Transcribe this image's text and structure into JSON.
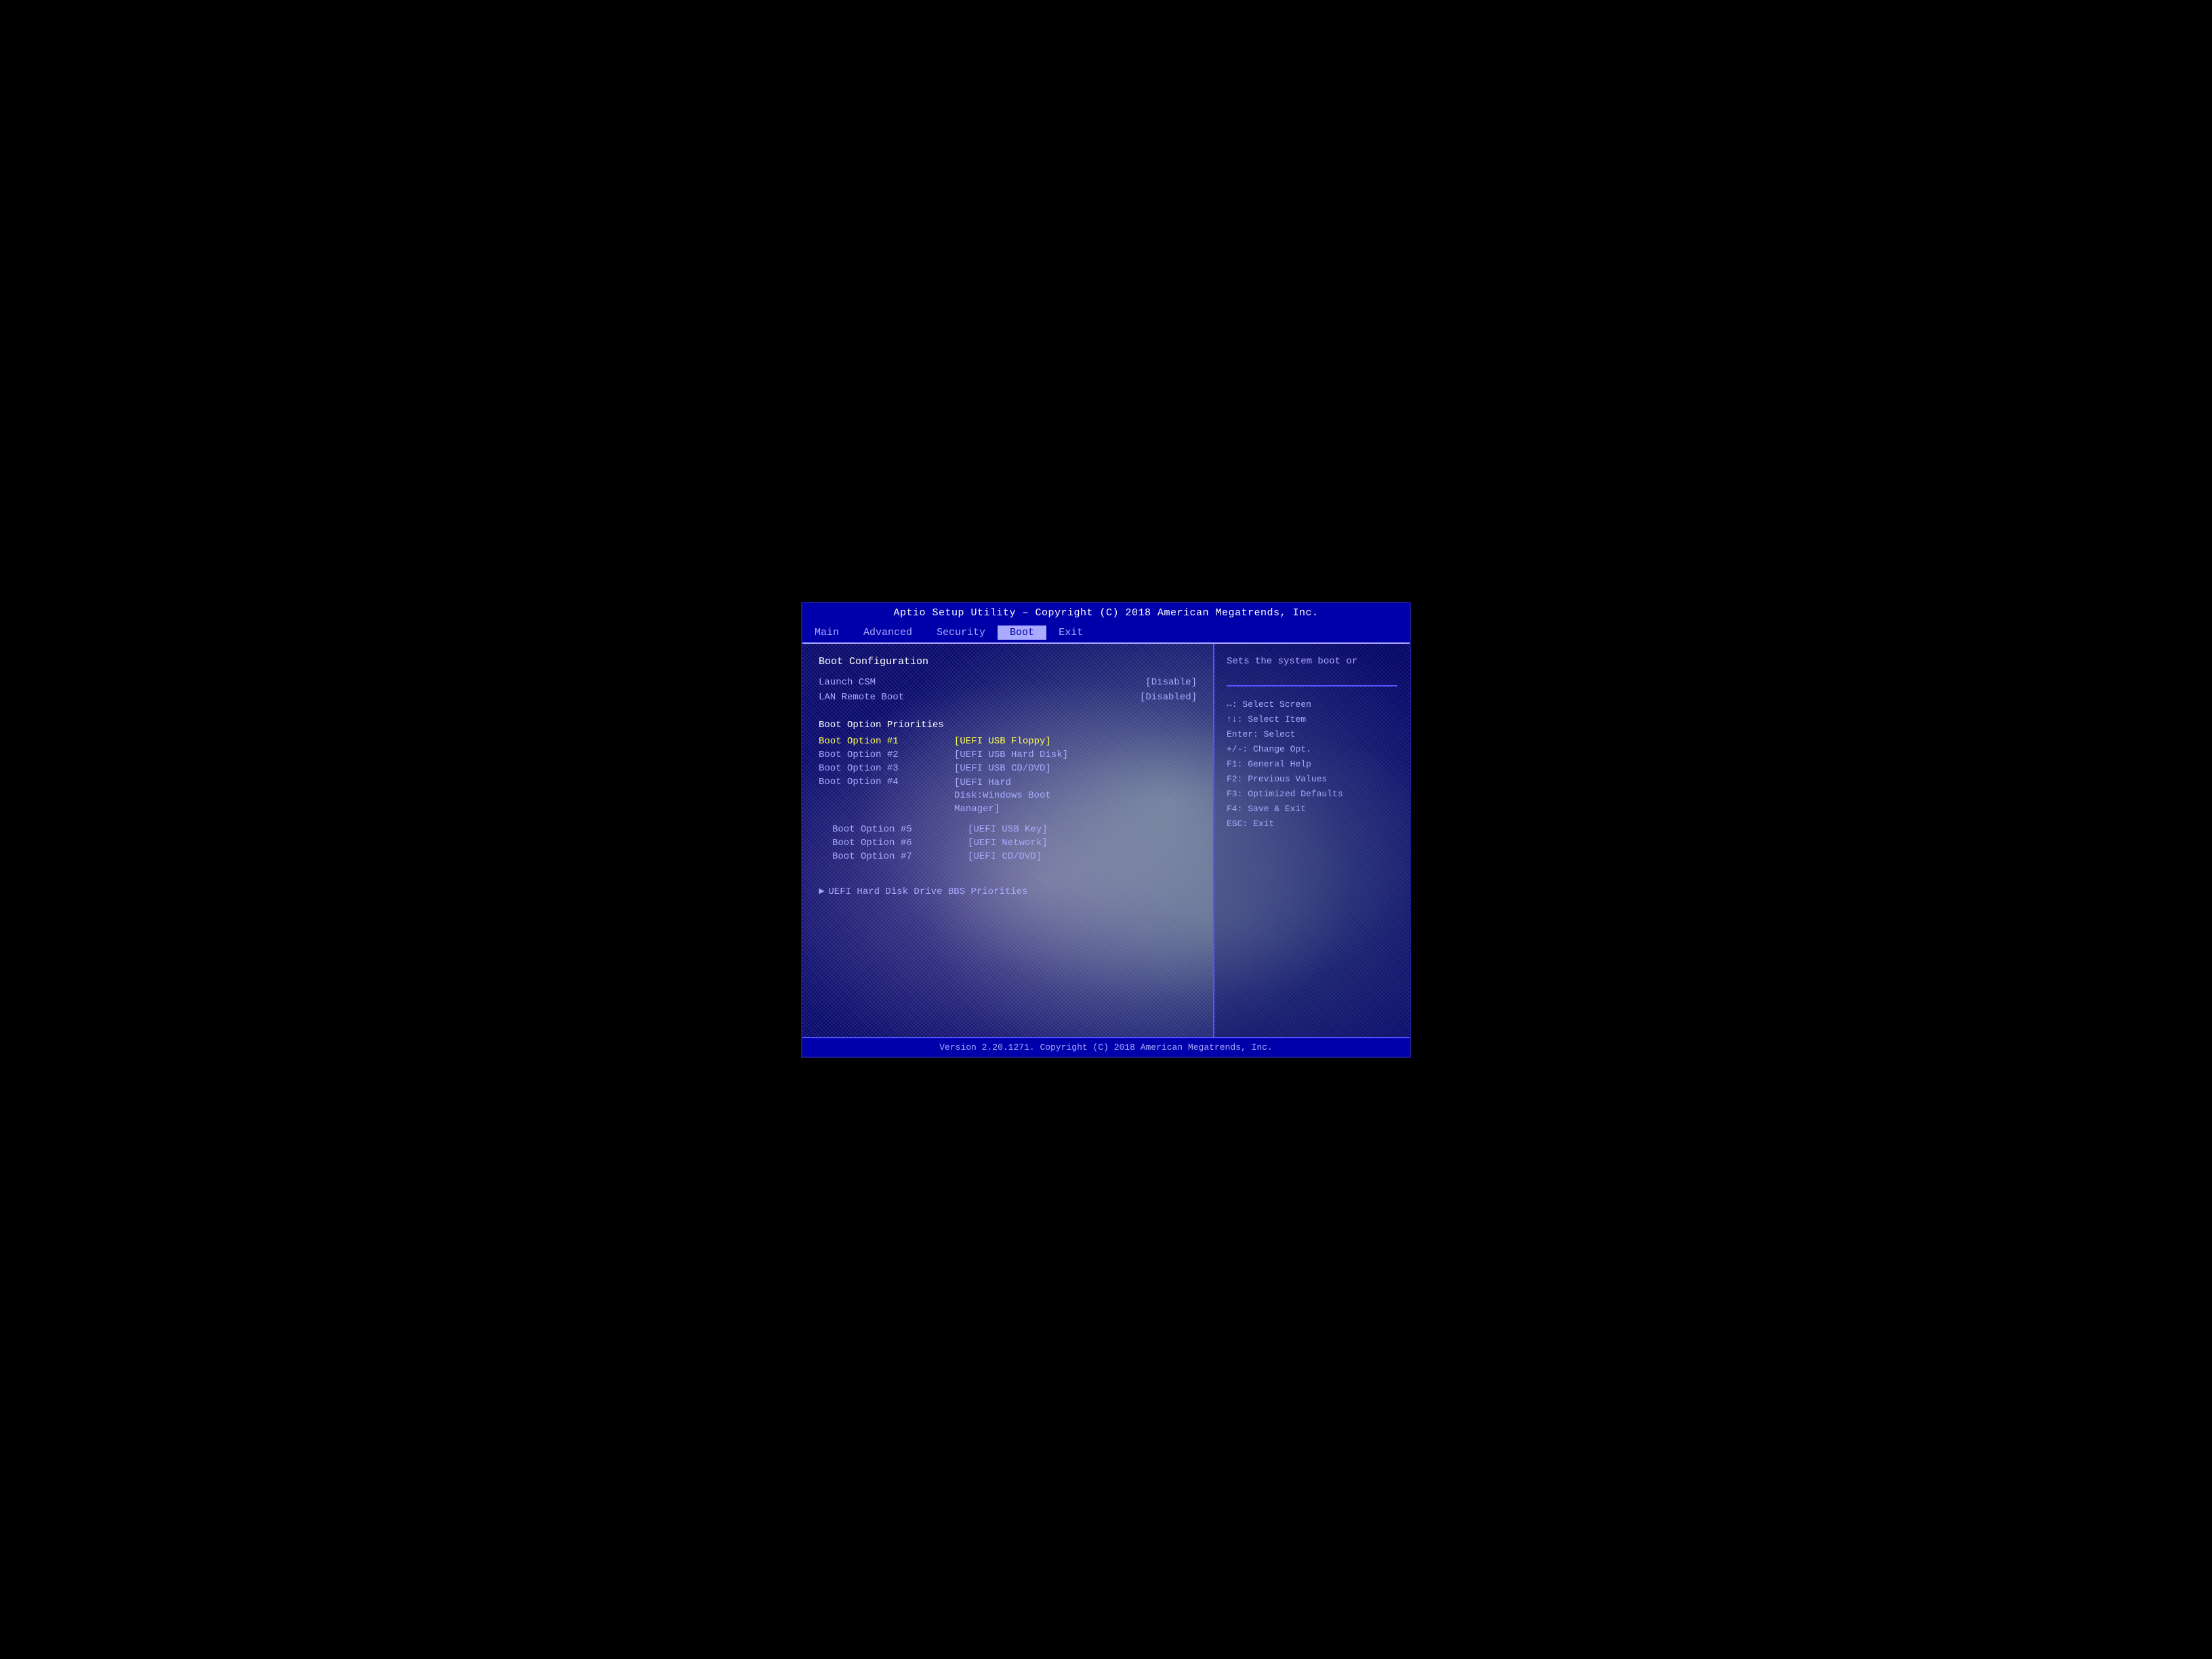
{
  "title_bar": {
    "text": "Aptio Setup Utility – Copyright (C) 2018 American Megatrends, Inc."
  },
  "menu": {
    "items": [
      {
        "label": "Main",
        "active": false
      },
      {
        "label": "Advanced",
        "active": false
      },
      {
        "label": "Security",
        "active": false
      },
      {
        "label": "Boot",
        "active": true
      },
      {
        "label": "Exit",
        "active": false
      }
    ]
  },
  "left_panel": {
    "section_title": "Boot Configuration",
    "rows": [
      {
        "label": "Launch CSM",
        "value": "[Disable]"
      },
      {
        "label": "LAN Remote Boot",
        "value": "[Disabled]"
      }
    ],
    "boot_priorities": {
      "title": "Boot Option Priorities",
      "options": [
        {
          "label": "Boot Option #1",
          "value": "[UEFI USB Floppy]",
          "highlighted": true
        },
        {
          "label": "Boot Option #2",
          "value": "[UEFI USB Hard Disk]",
          "highlighted": false
        },
        {
          "label": "Boot Option #3",
          "value": "[UEFI USB CD/DVD]",
          "highlighted": false
        },
        {
          "label": "Boot Option #4",
          "value": "[UEFI Hard Disk:Windows Boot Manager]",
          "highlighted": false
        },
        {
          "label": "Boot Option #5",
          "value": "[UEFI USB Key]",
          "highlighted": false,
          "indent": true
        },
        {
          "label": "Boot Option #6",
          "value": "[UEFI Network]",
          "highlighted": false,
          "indent": true
        },
        {
          "label": "Boot Option #7",
          "value": "[UEFI CD/DVD]",
          "highlighted": false,
          "indent": true
        }
      ]
    },
    "bbs": {
      "label": "UEFI Hard Disk Drive BBS Priorities",
      "arrow": "►"
    }
  },
  "right_panel": {
    "description": "Sets the system boot or",
    "help_items": [
      {
        "key": "↔:",
        "desc": "Select Screen"
      },
      {
        "key": "↑↓:",
        "desc": "Select Item"
      },
      {
        "key": "Enter:",
        "desc": "Select"
      },
      {
        "key": "+/-:",
        "desc": "Change Opt."
      },
      {
        "key": "F1:",
        "desc": "General Help"
      },
      {
        "key": "F2:",
        "desc": "Previous Values"
      },
      {
        "key": "F3:",
        "desc": "Optimized Defaults"
      },
      {
        "key": "F4:",
        "desc": "Save & Exit"
      },
      {
        "key": "ESC:",
        "desc": "Exit"
      }
    ]
  },
  "footer": {
    "text": "Version 2.20.1271. Copyright (C) 2018 American Megatrends, Inc."
  }
}
